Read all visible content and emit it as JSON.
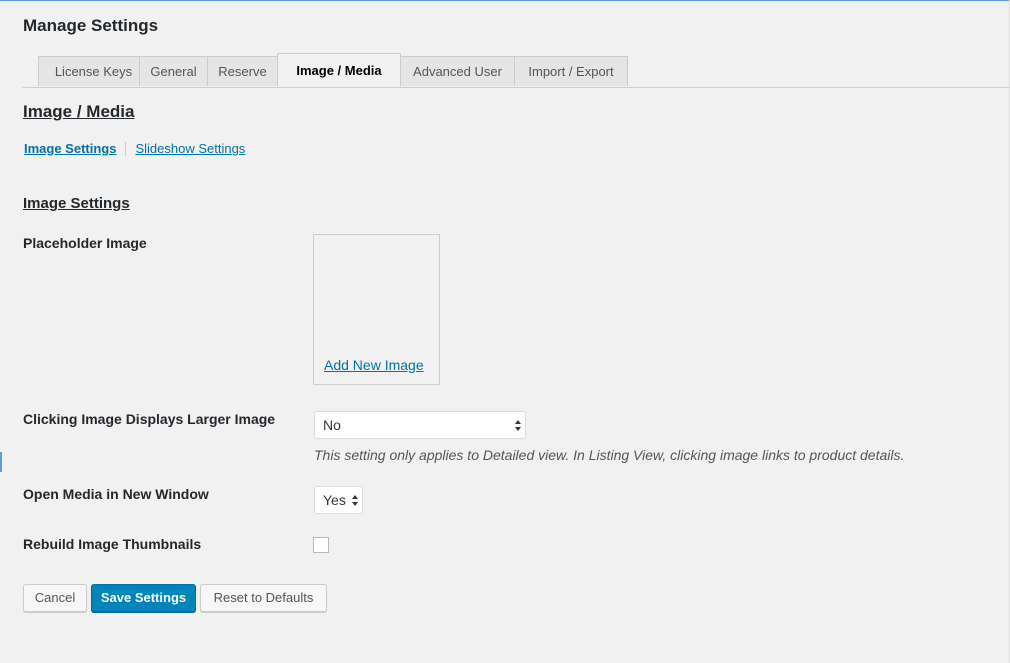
{
  "page_title": "Manage Settings",
  "tabs": [
    {
      "label": "License Keys",
      "active": false
    },
    {
      "label": "General",
      "active": false
    },
    {
      "label": "Reserve",
      "active": false
    },
    {
      "label": "Image / Media",
      "active": true
    },
    {
      "label": "Advanced User",
      "active": false
    },
    {
      "label": "Import / Export",
      "active": false
    }
  ],
  "section": {
    "heading": "Image / Media",
    "subnav": {
      "current": "Image Settings",
      "other": "Slideshow Settings"
    },
    "sub_heading": "Image Settings"
  },
  "fields": {
    "placeholder_image": {
      "label": "Placeholder Image",
      "add_link": "Add New Image"
    },
    "clicking_image": {
      "label": "Clicking Image Displays Larger Image",
      "value": "No",
      "help": "This setting only applies to Detailed view. In Listing View, clicking image links to product details."
    },
    "open_media": {
      "label": "Open Media in New Window",
      "value": "Yes"
    },
    "rebuild_thumbnails": {
      "label": "Rebuild Image Thumbnails",
      "checked": false
    }
  },
  "buttons": {
    "cancel": "Cancel",
    "save": "Save Settings",
    "reset": "Reset to Defaults"
  },
  "colors": {
    "link": "#0073aa",
    "primary": "#0085ba",
    "background": "#f1f1f1"
  }
}
